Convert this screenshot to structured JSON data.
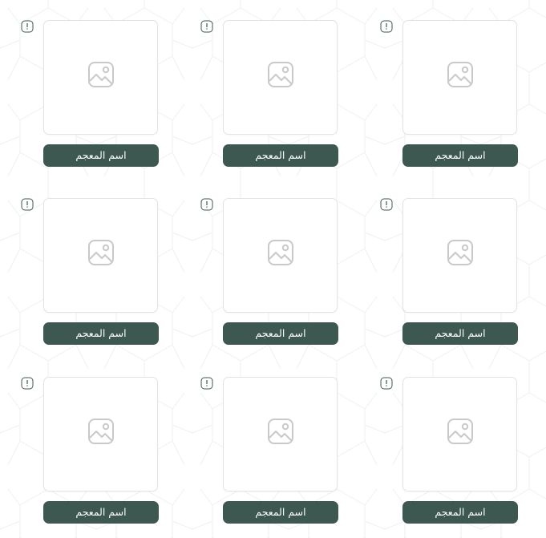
{
  "colors": {
    "button_bg": "#3d5751",
    "button_text": "#ffffff",
    "card_border": "#e3e3e3",
    "placeholder_icon": "#c9c9c9",
    "info_icon": "#3d5751"
  },
  "icons": {
    "info": "info-icon",
    "placeholder": "image-placeholder-icon"
  },
  "dictionaries": [
    {
      "name": "اسم المعجم"
    },
    {
      "name": "اسم المعجم"
    },
    {
      "name": "اسم المعجم"
    },
    {
      "name": "اسم المعجم"
    },
    {
      "name": "اسم المعجم"
    },
    {
      "name": "اسم المعجم"
    },
    {
      "name": "اسم المعجم"
    },
    {
      "name": "اسم المعجم"
    },
    {
      "name": "اسم المعجم"
    }
  ]
}
